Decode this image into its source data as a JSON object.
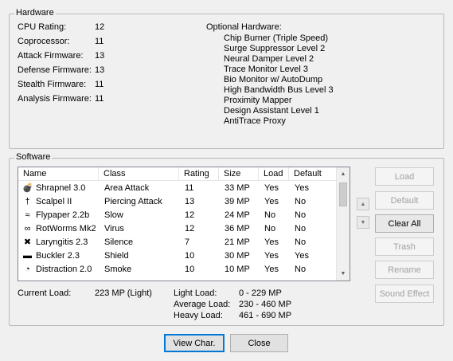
{
  "hardware": {
    "title": "Hardware",
    "stats": [
      {
        "label": "CPU Rating:",
        "value": "12"
      },
      {
        "label": "Coprocessor:",
        "value": "11"
      },
      {
        "label": "Attack Firmware:",
        "value": "13"
      },
      {
        "label": "Defense Firmware:",
        "value": "13"
      },
      {
        "label": "Stealth Firmware:",
        "value": "11"
      },
      {
        "label": "Analysis Firmware:",
        "value": "11"
      }
    ],
    "optional_title": "Optional Hardware:",
    "optional": [
      "Chip Burner (Triple Speed)",
      "Surge Suppressor Level 2",
      "Neural Damper Level 2",
      "Trace Monitor Level 3",
      "Bio Monitor w/ AutoDump",
      "High Bandwidth Bus Level 3",
      "Proximity Mapper",
      "Design Assistant Level 1",
      "AntiTrace Proxy"
    ]
  },
  "software": {
    "title": "Software",
    "columns": [
      "Name",
      "Class",
      "Rating",
      "Size",
      "Load",
      "Default"
    ],
    "rows": [
      {
        "icon": "bomb-icon",
        "glyph": "💣",
        "name": "Shrapnel 3.0",
        "class": "Area Attack",
        "rating": "11",
        "size": "33 MP",
        "load": "Yes",
        "default": "Yes"
      },
      {
        "icon": "scalpel-icon",
        "glyph": "†",
        "name": "Scalpel II",
        "class": "Piercing Attack",
        "rating": "13",
        "size": "39 MP",
        "load": "Yes",
        "default": "No"
      },
      {
        "icon": "flypaper-icon",
        "glyph": "≈",
        "name": "Flypaper 2.2b",
        "class": "Slow",
        "rating": "12",
        "size": "24 MP",
        "load": "No",
        "default": "No"
      },
      {
        "icon": "worm-icon",
        "glyph": "∞",
        "name": "RotWorms Mk2",
        "class": "Virus",
        "rating": "12",
        "size": "36 MP",
        "load": "No",
        "default": "No"
      },
      {
        "icon": "laryngitis-icon",
        "glyph": "✖",
        "name": "Laryngitis 2.3",
        "class": "Silence",
        "rating": "7",
        "size": "21 MP",
        "load": "Yes",
        "default": "No"
      },
      {
        "icon": "shield-icon",
        "glyph": "▬",
        "name": "Buckler 2.3",
        "class": "Shield",
        "rating": "10",
        "size": "30 MP",
        "load": "Yes",
        "default": "Yes"
      },
      {
        "icon": "smoke-icon",
        "glyph": "◔",
        "name": "Distraction 2.0",
        "class": "Smoke",
        "rating": "10",
        "size": "10 MP",
        "load": "Yes",
        "default": "No"
      }
    ],
    "current_load_label": "Current Load:",
    "current_load_value": "223 MP (Light)",
    "light_load_label": "Light  Load:",
    "light_load_value": "0 - 229 MP",
    "average_load_label": "Average  Load:",
    "average_load_value": "230 - 460 MP",
    "heavy_load_label": "Heavy  Load:",
    "heavy_load_value": "461 - 690 MP"
  },
  "buttons": {
    "load": "Load",
    "default": "Default",
    "clear_all": "Clear All",
    "trash": "Trash",
    "rename": "Rename",
    "sound_effect": "Sound Effect",
    "view_char": "View Char.",
    "close": "Close"
  }
}
